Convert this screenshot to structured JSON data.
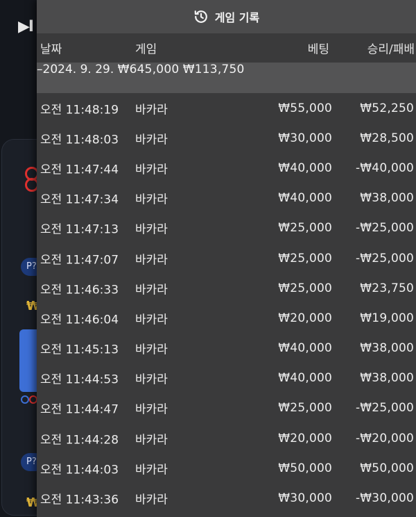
{
  "panel": {
    "title": "게임 기록",
    "icon": "history-icon"
  },
  "columns": {
    "date": "날짜",
    "game": "게임",
    "bet": "베팅",
    "result": "승리/패배"
  },
  "date_group": {
    "label": "–2024. 9. 29.",
    "bet_total": "₩645,000",
    "result_total": "₩113,750"
  },
  "rows": [
    {
      "time": "오전 11:48:19",
      "game": "바카라",
      "bet": "₩55,000",
      "result": "₩52,250"
    },
    {
      "time": "오전 11:48:03",
      "game": "바카라",
      "bet": "₩30,000",
      "result": "₩28,500"
    },
    {
      "time": "오전 11:47:44",
      "game": "바카라",
      "bet": "₩40,000",
      "result": "-₩40,000"
    },
    {
      "time": "오전 11:47:34",
      "game": "바카라",
      "bet": "₩40,000",
      "result": "₩38,000"
    },
    {
      "time": "오전 11:47:13",
      "game": "바카라",
      "bet": "₩25,000",
      "result": "-₩25,000"
    },
    {
      "time": "오전 11:47:07",
      "game": "바카라",
      "bet": "₩25,000",
      "result": "-₩25,000"
    },
    {
      "time": "오전 11:46:33",
      "game": "바카라",
      "bet": "₩25,000",
      "result": "₩23,750"
    },
    {
      "time": "오전 11:46:04",
      "game": "바카라",
      "bet": "₩20,000",
      "result": "₩19,000"
    },
    {
      "time": "오전 11:45:13",
      "game": "바카라",
      "bet": "₩40,000",
      "result": "₩38,000"
    },
    {
      "time": "오전 11:44:53",
      "game": "바카라",
      "bet": "₩40,000",
      "result": "₩38,000"
    },
    {
      "time": "오전 11:44:47",
      "game": "바카라",
      "bet": "₩25,000",
      "result": "-₩25,000"
    },
    {
      "time": "오전 11:44:28",
      "game": "바카라",
      "bet": "₩20,000",
      "result": "-₩20,000"
    },
    {
      "time": "오전 11:44:03",
      "game": "바카라",
      "bet": "₩50,000",
      "result": "₩50,000"
    },
    {
      "time": "오전 11:43:36",
      "game": "바카라",
      "bet": "₩30,000",
      "result": "-₩30,000"
    }
  ],
  "background": {
    "logo": "▶I",
    "pill_1": "P?",
    "pill_2": "P?",
    "won_1": "₩",
    "won_2": "₩",
    "accent_red": "#e0312f",
    "accent_blue": "#3d6fd6"
  }
}
